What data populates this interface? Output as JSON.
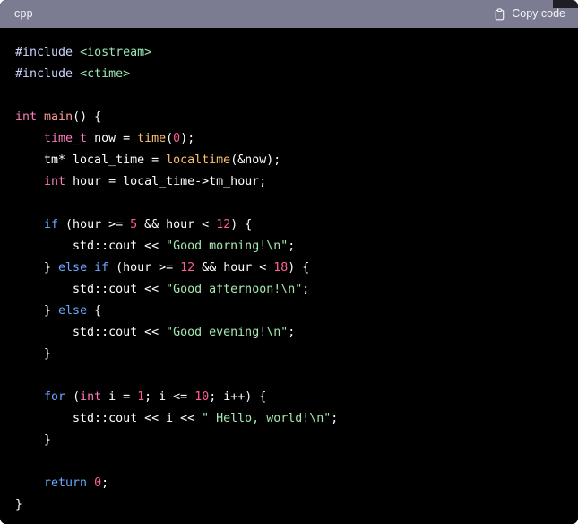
{
  "header": {
    "language_label": "cpp",
    "copy_label": "Copy code",
    "copy_icon": "clipboard-icon",
    "background_color": "#7b7b92",
    "text_color": "#f3f3f7"
  },
  "theme": {
    "code_background": "#000000",
    "default_text": "#ffffff",
    "preprocessor": "#ccd6ff",
    "include_path": "#98e8b8",
    "type_keyword": "#ff7bbf",
    "control_keyword": "#6aa9ff",
    "function": "#ffc36b",
    "main_identifier": "#ff9d9d",
    "number": "#ff5c93",
    "string": "#a5e8b0"
  },
  "code": {
    "language": "cpp",
    "plain_text": "#include <iostream>\n#include <ctime>\n\nint main() {\n    time_t now = time(0);\n    tm* local_time = localtime(&now);\n    int hour = local_time->tm_hour;\n\n    if (hour >= 5 && hour < 12) {\n        std::cout << \"Good morning!\\n\";\n    } else if (hour >= 12 && hour < 18) {\n        std::cout << \"Good afternoon!\\n\";\n    } else {\n        std::cout << \"Good evening!\\n\";\n    }\n\n    for (int i = 1; i <= 10; i++) {\n        std::cout << i << \" Hello, world!\\n\";\n    }\n\n    return 0;\n}",
    "lines": [
      {
        "tokens": [
          {
            "t": "#include",
            "c": "pp"
          },
          {
            "t": " ",
            "c": "pln"
          },
          {
            "t": "<iostream>",
            "c": "inc"
          }
        ]
      },
      {
        "tokens": [
          {
            "t": "#include",
            "c": "pp"
          },
          {
            "t": " ",
            "c": "pln"
          },
          {
            "t": "<ctime>",
            "c": "inc"
          }
        ]
      },
      {
        "tokens": []
      },
      {
        "tokens": [
          {
            "t": "int",
            "c": "kw"
          },
          {
            "t": " ",
            "c": "pln"
          },
          {
            "t": "main",
            "c": "main"
          },
          {
            "t": "() {",
            "c": "pln"
          }
        ]
      },
      {
        "tokens": [
          {
            "t": "    ",
            "c": "pln"
          },
          {
            "t": "time_t",
            "c": "kw"
          },
          {
            "t": " now = ",
            "c": "pln"
          },
          {
            "t": "time",
            "c": "fn"
          },
          {
            "t": "(",
            "c": "pln"
          },
          {
            "t": "0",
            "c": "num"
          },
          {
            "t": ");",
            "c": "pln"
          }
        ]
      },
      {
        "tokens": [
          {
            "t": "    tm* local_time = ",
            "c": "pln"
          },
          {
            "t": "localtime",
            "c": "fn"
          },
          {
            "t": "(&now);",
            "c": "pln"
          }
        ]
      },
      {
        "tokens": [
          {
            "t": "    ",
            "c": "pln"
          },
          {
            "t": "int",
            "c": "kw"
          },
          {
            "t": " hour = local_time->tm_hour;",
            "c": "pln"
          }
        ]
      },
      {
        "tokens": []
      },
      {
        "tokens": [
          {
            "t": "    ",
            "c": "pln"
          },
          {
            "t": "if",
            "c": "ctl"
          },
          {
            "t": " (hour >= ",
            "c": "pln"
          },
          {
            "t": "5",
            "c": "num"
          },
          {
            "t": " && hour < ",
            "c": "pln"
          },
          {
            "t": "12",
            "c": "num"
          },
          {
            "t": ") {",
            "c": "pln"
          }
        ]
      },
      {
        "tokens": [
          {
            "t": "        std::cout << ",
            "c": "pln"
          },
          {
            "t": "\"Good morning!\\n\"",
            "c": "str"
          },
          {
            "t": ";",
            "c": "pln"
          }
        ]
      },
      {
        "tokens": [
          {
            "t": "    } ",
            "c": "pln"
          },
          {
            "t": "else",
            "c": "ctl"
          },
          {
            "t": " ",
            "c": "pln"
          },
          {
            "t": "if",
            "c": "ctl"
          },
          {
            "t": " (hour >= ",
            "c": "pln"
          },
          {
            "t": "12",
            "c": "num"
          },
          {
            "t": " && hour < ",
            "c": "pln"
          },
          {
            "t": "18",
            "c": "num"
          },
          {
            "t": ") {",
            "c": "pln"
          }
        ]
      },
      {
        "tokens": [
          {
            "t": "        std::cout << ",
            "c": "pln"
          },
          {
            "t": "\"Good afternoon!\\n\"",
            "c": "str"
          },
          {
            "t": ";",
            "c": "pln"
          }
        ]
      },
      {
        "tokens": [
          {
            "t": "    } ",
            "c": "pln"
          },
          {
            "t": "else",
            "c": "ctl"
          },
          {
            "t": " {",
            "c": "pln"
          }
        ]
      },
      {
        "tokens": [
          {
            "t": "        std::cout << ",
            "c": "pln"
          },
          {
            "t": "\"Good evening!\\n\"",
            "c": "str"
          },
          {
            "t": ";",
            "c": "pln"
          }
        ]
      },
      {
        "tokens": [
          {
            "t": "    }",
            "c": "pln"
          }
        ]
      },
      {
        "tokens": []
      },
      {
        "tokens": [
          {
            "t": "    ",
            "c": "pln"
          },
          {
            "t": "for",
            "c": "ctl"
          },
          {
            "t": " (",
            "c": "pln"
          },
          {
            "t": "int",
            "c": "kw"
          },
          {
            "t": " i = ",
            "c": "pln"
          },
          {
            "t": "1",
            "c": "num"
          },
          {
            "t": "; i <= ",
            "c": "pln"
          },
          {
            "t": "10",
            "c": "num"
          },
          {
            "t": "; i++) {",
            "c": "pln"
          }
        ]
      },
      {
        "tokens": [
          {
            "t": "        std::cout << i << ",
            "c": "pln"
          },
          {
            "t": "\" Hello, world!\\n\"",
            "c": "str"
          },
          {
            "t": ";",
            "c": "pln"
          }
        ]
      },
      {
        "tokens": [
          {
            "t": "    }",
            "c": "pln"
          }
        ]
      },
      {
        "tokens": []
      },
      {
        "tokens": [
          {
            "t": "    ",
            "c": "pln"
          },
          {
            "t": "return",
            "c": "ctl"
          },
          {
            "t": " ",
            "c": "pln"
          },
          {
            "t": "0",
            "c": "num"
          },
          {
            "t": ";",
            "c": "pln"
          }
        ]
      },
      {
        "tokens": [
          {
            "t": "}",
            "c": "pln"
          }
        ]
      }
    ]
  }
}
